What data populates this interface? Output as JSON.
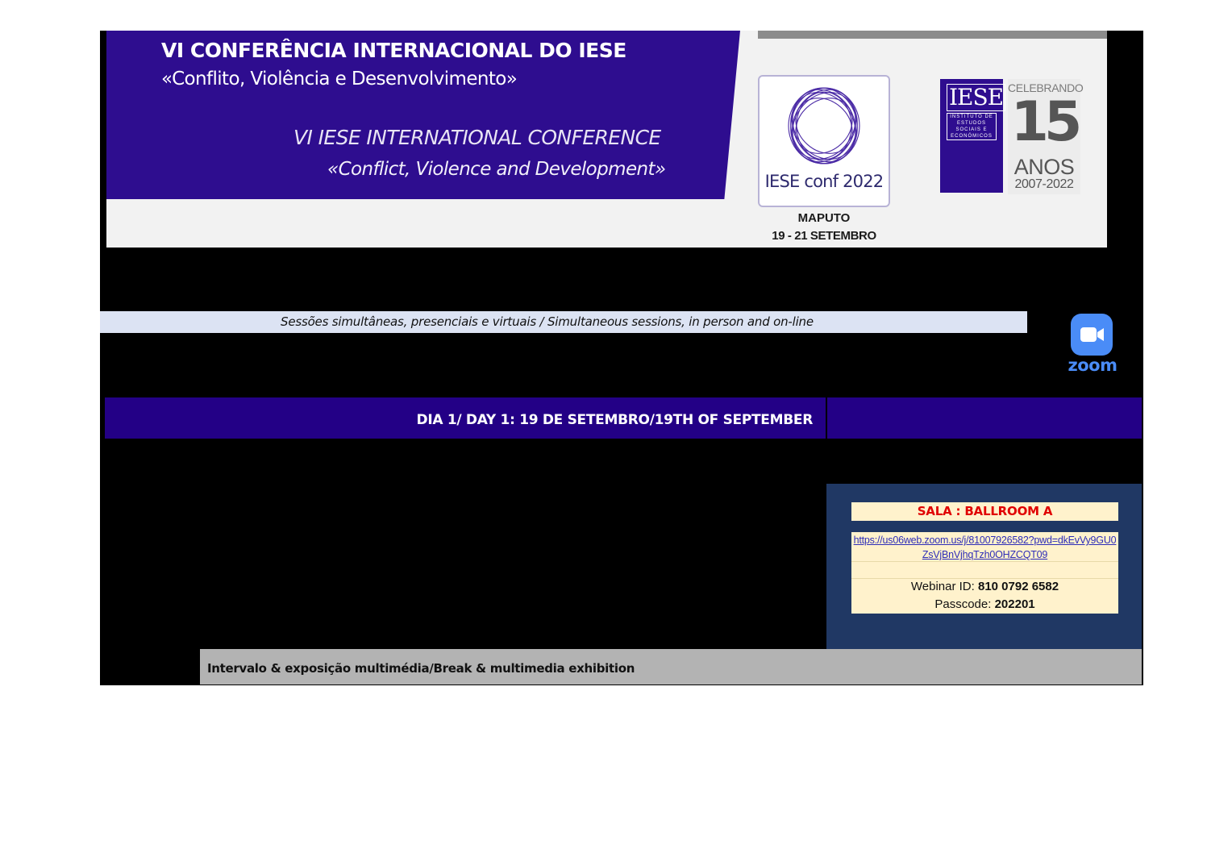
{
  "banner": {
    "title_pt": "VI CONFERÊNCIA INTERNACIONAL DO IESE",
    "theme_pt": "«Conflito, Violência e Desenvolvimento»",
    "title_en": "VI IESE INTERNATIONAL CONFERENCE",
    "theme_en": "«Conflict, Violence and Development»",
    "conf_logo_label": "IESE conf 2022",
    "city": "MAPUTO",
    "dates": "19 - 21 SETEMBRO",
    "iese_logo_text": "IESE",
    "iese_logo_subtext": "INSTITUTO DE ESTUDOS SOCIAIS E ECONÓMICOS",
    "anniversary_top": "CELEBRANDO",
    "anniversary_number": "15",
    "anniversary_word": "ANOS",
    "anniversary_years": "2007-2022",
    "purple_color": "#2e0d8f"
  },
  "sessions_note": "Sessões simultâneas, presenciais e virtuais / Simultaneous sessions, in person and on-line",
  "zoom": {
    "label": "zoom",
    "icon": "video-camera-icon",
    "color": "#4a8cf7"
  },
  "day_header": "DIA 1/ DAY 1: 19 DE SETEMBRO/19TH OF SEPTEMBER",
  "room": {
    "label": "SALA : BALLROOM A",
    "zoom_link": "https://us06web.zoom.us/j/81007926582?pwd=dkEvVy9GU0ZsVjBnVjhqTzh0OHZCQT09",
    "webinar_label": "Webinar ID: ",
    "webinar_id": "810 0792 6582",
    "passcode_label": "Passcode: ",
    "passcode": "202201",
    "label_color": "#e00000",
    "panel_color": "#203864"
  },
  "break_row": "Intervalo & exposição multimédia/Break & multimedia exhibition"
}
